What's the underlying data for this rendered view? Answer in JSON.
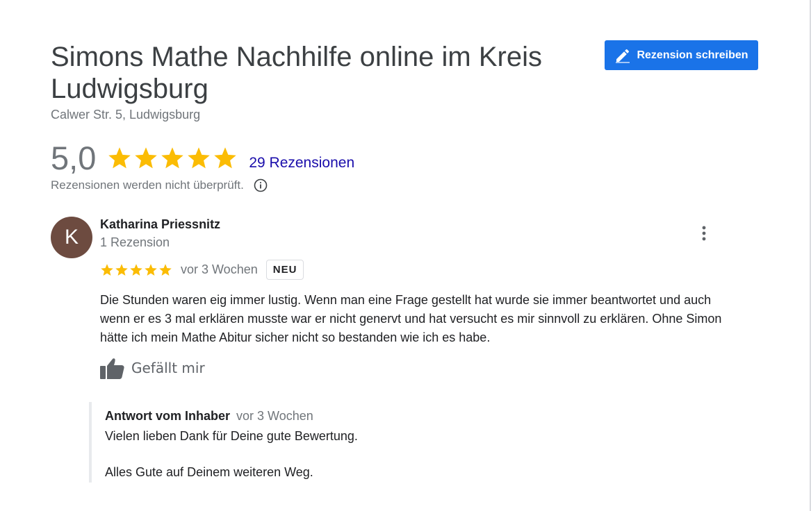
{
  "business": {
    "name": "Simons Mathe Nachhilfe online im Kreis Ludwigsburg",
    "address": "Calwer Str. 5, Ludwigsburg"
  },
  "write_review_label": "Rezension schreiben",
  "summary": {
    "rating_text": "5,0",
    "rating": 5,
    "max_rating": 5,
    "review_count_label": "29 Rezensionen",
    "unverified_notice": "Rezensionen werden nicht überprüft."
  },
  "review": {
    "avatar_initial": "K",
    "reviewer_name": "Katharina Priessnitz",
    "reviewer_review_count": "1 Rezension",
    "rating": 5,
    "time": "vor 3 Wochen",
    "badge": "NEU",
    "text": "Die Stunden waren eig immer lustig. Wenn man eine Frage gestellt hat wurde sie immer beantwortet und auch wenn er es 3 mal erklären musste war er nicht genervt und hat versucht es mir sinnvoll zu erklären. Ohne Simon hätte ich mein Mathe Abitur sicher nicht so bestanden wie ich es habe.",
    "like_label": "Gefällt mir"
  },
  "owner_reply": {
    "author": "Antwort vom Inhaber",
    "time": "vor 3 Wochen",
    "line1": "Vielen lieben Dank für Deine gute Bewertung.",
    "line2": "Alles Gute auf Deinem weiteren Weg."
  },
  "colors": {
    "star": "#fbbc04",
    "button": "#1a73e8",
    "link": "#1a0dab",
    "avatar": "#6d4b40"
  },
  "icons": {
    "write_button": "pencil-icon",
    "star": "star-icon",
    "info": "info-icon",
    "more": "more-vertical-icon",
    "like": "thumbs-up-icon"
  }
}
